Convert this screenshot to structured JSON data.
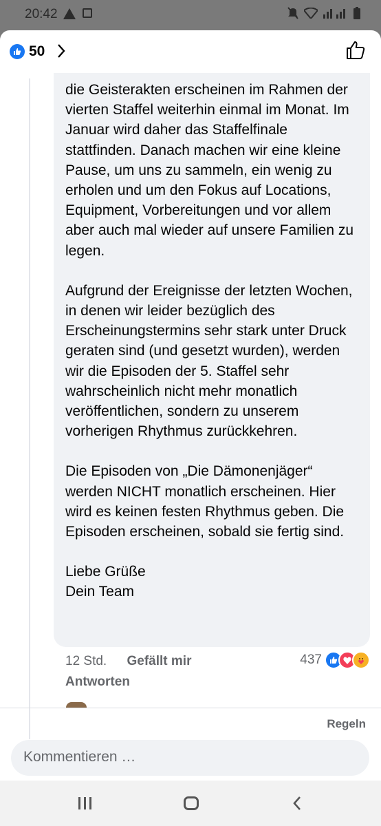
{
  "status_bar": {
    "time": "20:42"
  },
  "header": {
    "like_count": "50"
  },
  "comment": {
    "paragraphs": [
      "die Geisterakten erscheinen im Rahmen der vierten Staffel weiterhin einmal im Monat. Im Januar wird daher das Staffelfinale stattfinden. Danach machen wir eine kleine Pause, um uns zu sammeln, ein wenig zu erholen und um den Fokus auf Locations, Equipment, Vorbereitungen und vor allem aber auch mal wieder auf unsere Familien zu legen.",
      "Aufgrund der Ereignisse der letzten Wochen, in denen wir leider bezüglich des Erscheinungstermins sehr stark unter Druck geraten sind (und gesetzt wurden), werden wir die Episoden der 5. Staffel sehr wahrscheinlich nicht mehr monatlich veröffentlichen, sondern zu unserem vorherigen Rhythmus zurückkehren.",
      "Die Episoden von „Die Dämonenjäger“ werden NICHT monatlich erscheinen. Hier wird es keinen festen Rhythmus geben. Die Episoden erscheinen, sobald sie fertig sind.",
      "Liebe Grüße",
      "Dein Team"
    ],
    "time": "12 Std.",
    "like_label": "Gefällt mir",
    "reply_label": "Antworten",
    "reaction_count": "437"
  },
  "footer": {
    "rules_label": "Regeln",
    "comment_placeholder": "Kommentieren …"
  },
  "colors": {
    "facebook_blue": "#1877f2",
    "love_red": "#f33e58",
    "care_yellow": "#f7b125",
    "bubble_bg": "#f0f2f5",
    "meta_gray": "#65676b"
  },
  "icons": {
    "header_like": "like-icon",
    "header_next": "chevron-right-icon",
    "header_action": "thumbs-up-outline-icon",
    "reactions": [
      "like-reaction-icon",
      "love-reaction-icon",
      "care-reaction-icon"
    ],
    "nav": [
      "recent-apps-icon",
      "home-icon",
      "back-icon"
    ]
  }
}
